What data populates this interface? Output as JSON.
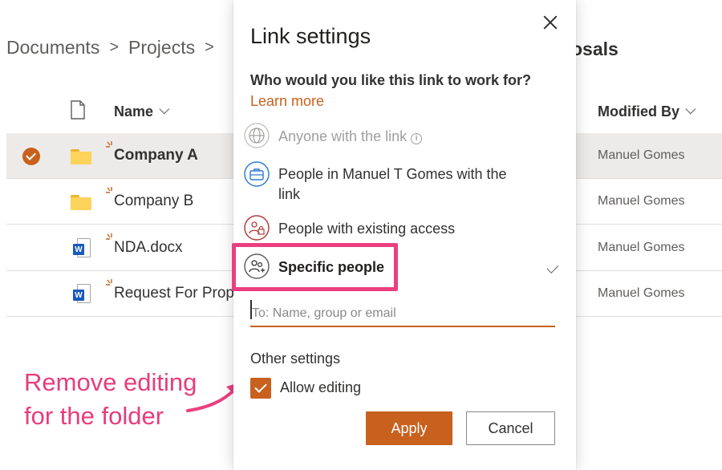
{
  "breadcrumb": {
    "items": [
      "Documents",
      "Projects"
    ],
    "separator": ">",
    "current_partial": "osals"
  },
  "columns": {
    "name": "Name",
    "modified_by": "Modified By"
  },
  "rows": [
    {
      "name": "Company A",
      "type": "folder",
      "modified_by": "Manuel Gomes",
      "selected": true
    },
    {
      "name": "Company B",
      "type": "folder",
      "modified_by": "Manuel Gomes",
      "selected": false
    },
    {
      "name": "NDA.docx",
      "type": "word",
      "modified_by": "Manuel Gomes",
      "selected": false
    },
    {
      "name": "Request For Prop",
      "type": "word",
      "modified_by": "Manuel Gomes",
      "selected": false
    }
  ],
  "dialog": {
    "title": "Link settings",
    "question": "Who would you like this link to work for?",
    "learn_more": "Learn more",
    "options": [
      {
        "label": "Anyone with the link",
        "icon": "globe-icon",
        "disabled": true,
        "info_glyph": "i"
      },
      {
        "label": "People in Manuel T Gomes with the link",
        "icon": "briefcase-icon",
        "disabled": false
      },
      {
        "label": "People with existing access",
        "icon": "people-lock-icon",
        "disabled": false
      },
      {
        "label": "Specific people",
        "icon": "people-add-icon",
        "disabled": false,
        "selected": true
      }
    ],
    "to_placeholder": "To: Name, group or email",
    "to_value": "",
    "other_settings": "Other settings",
    "allow_editing_label": "Allow editing",
    "allow_editing_checked": true,
    "apply_label": "Apply",
    "cancel_label": "Cancel"
  },
  "annotation": {
    "line1": "Remove editing",
    "line2": "for the folder"
  },
  "colors": {
    "accent": "#c8611d",
    "annotation": "#e83c7b",
    "word_blue": "#185abd",
    "folder_yellow": "#fcd35b"
  }
}
